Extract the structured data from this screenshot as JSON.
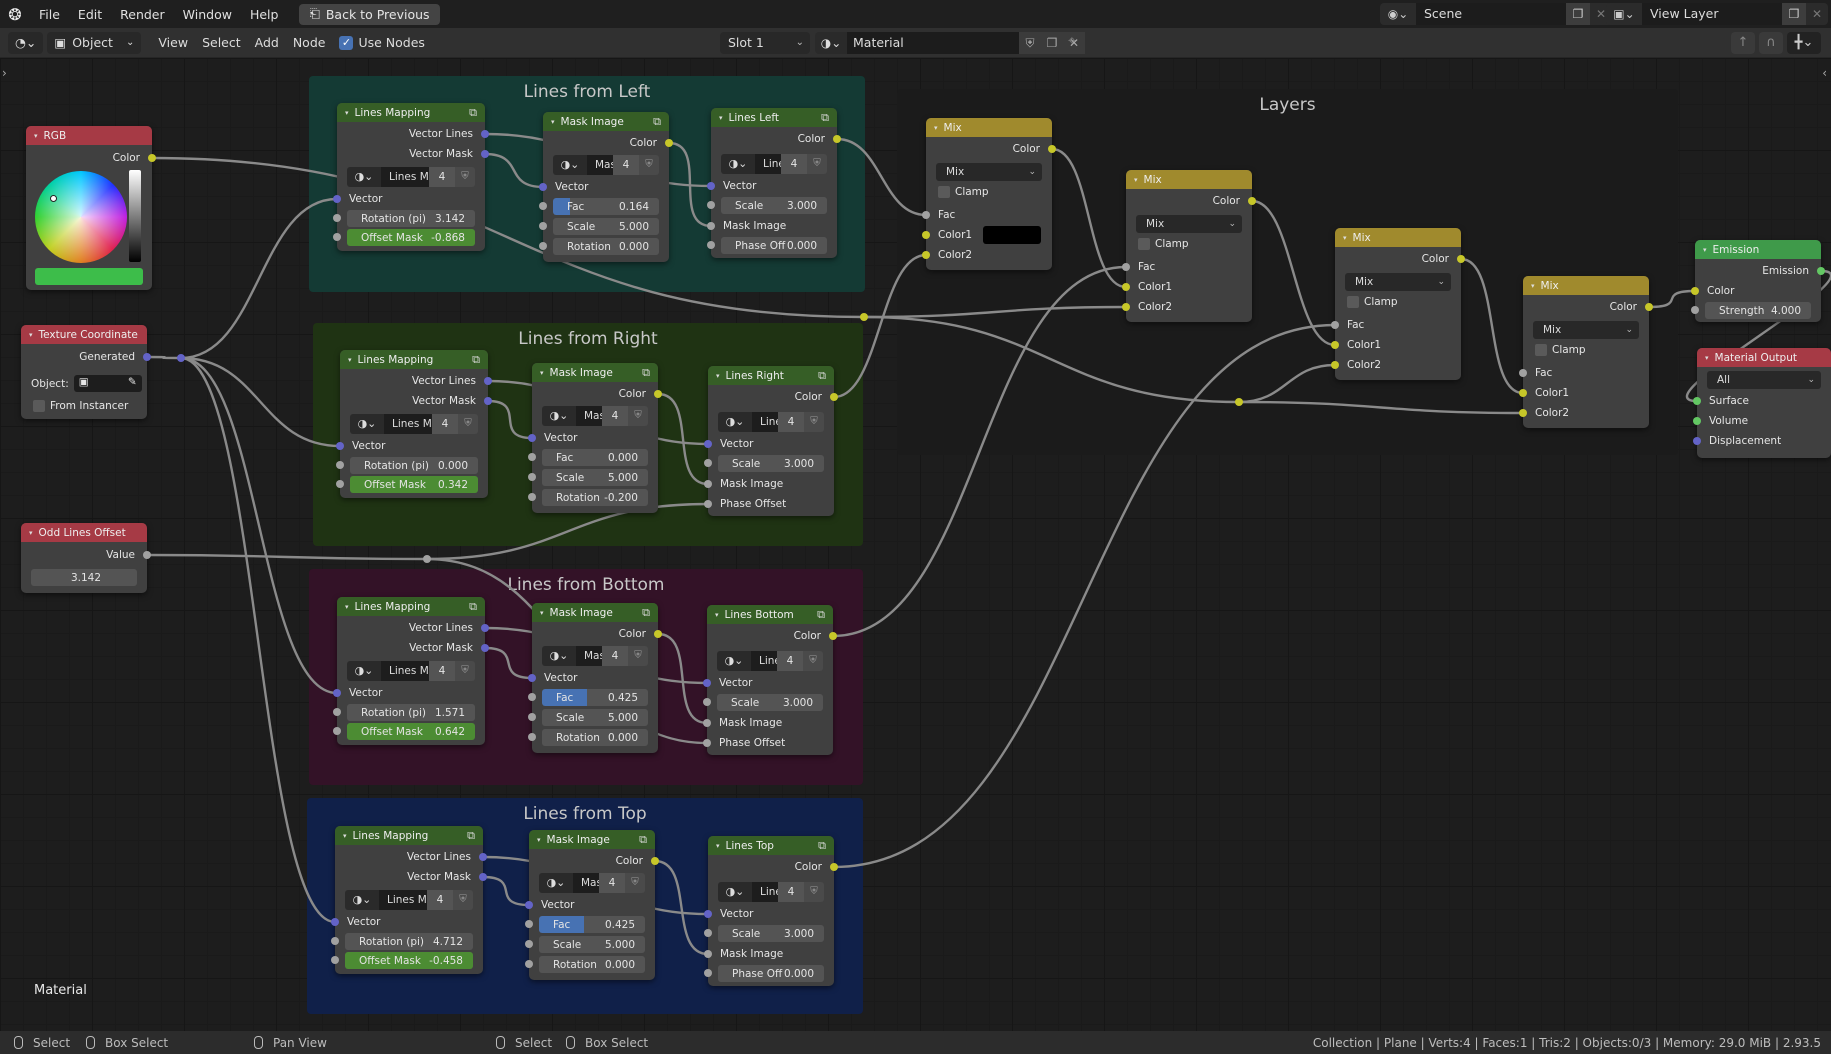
{
  "menu": {
    "items": [
      "File",
      "Edit",
      "Render",
      "Window",
      "Help"
    ],
    "back_to_previous": "Back to Previous"
  },
  "scene": {
    "label": "Scene",
    "view_layer": "View Layer"
  },
  "header": {
    "mode": "Object",
    "menus": [
      "View",
      "Select",
      "Add",
      "Node"
    ],
    "use_nodes_label": "Use Nodes",
    "use_nodes_checked": true,
    "slot": "Slot 1",
    "material": "Material"
  },
  "frames": [
    {
      "id": "left",
      "title": "Lines from Left",
      "color": "#143a34"
    },
    {
      "id": "right",
      "title": "Lines from Right",
      "color": "#1f3313"
    },
    {
      "id": "bottom",
      "title": "Lines from Bottom",
      "color": "#331227"
    },
    {
      "id": "top",
      "title": "Lines from Top",
      "color": "#102049"
    },
    {
      "id": "layers",
      "title": "Layers",
      "color": "#1b1b1b"
    }
  ],
  "nodes": {
    "rgb": {
      "title": "RGB",
      "output": "Color",
      "swatch_color": "#3dbd4a"
    },
    "tex_coord": {
      "title": "Texture Coordinate",
      "output": "Generated",
      "object_label": "Object:",
      "from_instancer": "From Instancer"
    },
    "odd_offset": {
      "title": "Odd Lines Offset",
      "output": "Value",
      "value": "3.142"
    },
    "groups": [
      {
        "mapping": {
          "title": "Lines Mapping",
          "out1": "Vector Lines",
          "out2": "Vector Mask",
          "datablock": "Lines Ma...",
          "users": "4",
          "in_vector": "Vector",
          "rotation_label": "Rotation (pi)",
          "rotation": "3.142",
          "offset_label": "Offset Mask",
          "offset": "-0.868"
        },
        "mask": {
          "title": "Mask Image",
          "out": "Color",
          "datablock": "Mas...",
          "users": "4",
          "in_vector": "Vector",
          "fac_label": "Fac",
          "fac": "0.164",
          "fac_fraction": 0.164,
          "scale_label": "Scale",
          "scale": "5.000",
          "rotation_label": "Rotation",
          "rotation": "0.000"
        },
        "lines": {
          "title": "Lines Left",
          "out": "Color",
          "datablock": "Lines",
          "users": "4",
          "in_vector": "Vector",
          "scale_label": "Scale",
          "scale": "3.000",
          "mask_label": "Mask Image",
          "phase_label": "Phase Off",
          "phase": "0.000",
          "phase_linked": false
        }
      },
      {
        "mapping": {
          "title": "Lines Mapping",
          "out1": "Vector Lines",
          "out2": "Vector Mask",
          "datablock": "Lines Ma...",
          "users": "4",
          "in_vector": "Vector",
          "rotation_label": "Rotation (pi)",
          "rotation": "0.000",
          "offset_label": "Offset Mask",
          "offset": "0.342"
        },
        "mask": {
          "title": "Mask Image",
          "out": "Color",
          "datablock": "Mas...",
          "users": "4",
          "in_vector": "Vector",
          "fac_label": "Fac",
          "fac": "0.000",
          "fac_fraction": 0.0,
          "scale_label": "Scale",
          "scale": "5.000",
          "rotation_label": "Rotation",
          "rotation": "-0.200"
        },
        "lines": {
          "title": "Lines Right",
          "out": "Color",
          "datablock": "Lines",
          "users": "4",
          "in_vector": "Vector",
          "scale_label": "Scale",
          "scale": "3.000",
          "mask_label": "Mask Image",
          "phase_label": "Phase Offset",
          "phase": "",
          "phase_linked": true
        }
      },
      {
        "mapping": {
          "title": "Lines Mapping",
          "out1": "Vector Lines",
          "out2": "Vector Mask",
          "datablock": "Lines Ma...",
          "users": "4",
          "in_vector": "Vector",
          "rotation_label": "Rotation (pi)",
          "rotation": "1.571",
          "offset_label": "Offset Mask",
          "offset": "0.642"
        },
        "mask": {
          "title": "Mask Image",
          "out": "Color",
          "datablock": "Mas...",
          "users": "4",
          "in_vector": "Vector",
          "fac_label": "Fac",
          "fac": "0.425",
          "fac_fraction": 0.425,
          "scale_label": "Scale",
          "scale": "5.000",
          "rotation_label": "Rotation",
          "rotation": "0.000"
        },
        "lines": {
          "title": "Lines Bottom",
          "out": "Color",
          "datablock": "Lines",
          "users": "4",
          "in_vector": "Vector",
          "scale_label": "Scale",
          "scale": "3.000",
          "mask_label": "Mask Image",
          "phase_label": "Phase Offset",
          "phase": "",
          "phase_linked": true
        }
      },
      {
        "mapping": {
          "title": "Lines Mapping",
          "out1": "Vector Lines",
          "out2": "Vector Mask",
          "datablock": "Lines Ma...",
          "users": "4",
          "in_vector": "Vector",
          "rotation_label": "Rotation (pi)",
          "rotation": "4.712",
          "offset_label": "Offset Mask",
          "offset": "-0.458"
        },
        "mask": {
          "title": "Mask Image",
          "out": "Color",
          "datablock": "Mas...",
          "users": "4",
          "in_vector": "Vector",
          "fac_label": "Fac",
          "fac": "0.425",
          "fac_fraction": 0.425,
          "scale_label": "Scale",
          "scale": "5.000",
          "rotation_label": "Rotation",
          "rotation": "0.000"
        },
        "lines": {
          "title": "Lines Top",
          "out": "Color",
          "datablock": "Lines",
          "users": "4",
          "in_vector": "Vector",
          "scale_label": "Scale",
          "scale": "3.000",
          "mask_label": "Mask Image",
          "phase_label": "Phase Off",
          "phase": "0.000",
          "phase_linked": false
        }
      }
    ],
    "mixes": [
      {
        "title": "Mix",
        "out": "Color",
        "blend": "Mix",
        "clamp": "Clamp",
        "fac": "Fac",
        "color1": "Color1",
        "color2": "Color2",
        "color1_swatch": true
      },
      {
        "title": "Mix",
        "out": "Color",
        "blend": "Mix",
        "clamp": "Clamp",
        "fac": "Fac",
        "color1": "Color1",
        "color2": "Color2",
        "color1_swatch": false
      },
      {
        "title": "Mix",
        "out": "Color",
        "blend": "Mix",
        "clamp": "Clamp",
        "fac": "Fac",
        "color1": "Color1",
        "color2": "Color2",
        "color1_swatch": false
      },
      {
        "title": "Mix",
        "out": "Color",
        "blend": "Mix",
        "clamp": "Clamp",
        "fac": "Fac",
        "color1": "Color1",
        "color2": "Color2",
        "color1_swatch": false
      }
    ],
    "emission": {
      "title": "Emission",
      "out": "Emission",
      "color": "Color",
      "strength_label": "Strength",
      "strength": "4.000"
    },
    "output": {
      "title": "Material Output",
      "target": "All",
      "surface": "Surface",
      "volume": "Volume",
      "displacement": "Displacement"
    }
  },
  "canvas_label": "Material",
  "colors": {
    "header_input": "#a63a45",
    "header_group": "#365e26",
    "header_mix": "#a08a2d",
    "header_shader": "#3f9a4a",
    "header_output": "#a63a45",
    "socket_vector": "#6363c7",
    "socket_color": "#c7c729",
    "socket_float": "#a1a1a1",
    "socket_shader": "#63c763",
    "wire": "#8a8a8a"
  },
  "statusbar": {
    "left": [
      {
        "icon": "mouse-left-icon",
        "label": "Select"
      },
      {
        "icon": "mouse-drag-icon",
        "label": "Box Select"
      },
      {
        "icon": "mouse-middle-icon",
        "label": "Pan View"
      },
      {
        "icon": "mouse-left-icon",
        "label": "Select"
      },
      {
        "icon": "mouse-drag-icon",
        "label": "Box Select"
      }
    ],
    "stats": "Collection | Plane | Verts:4 | Faces:1 | Tris:2 | Objects:0/3 | Memory: 29.0 MiB | 2.93.5"
  }
}
